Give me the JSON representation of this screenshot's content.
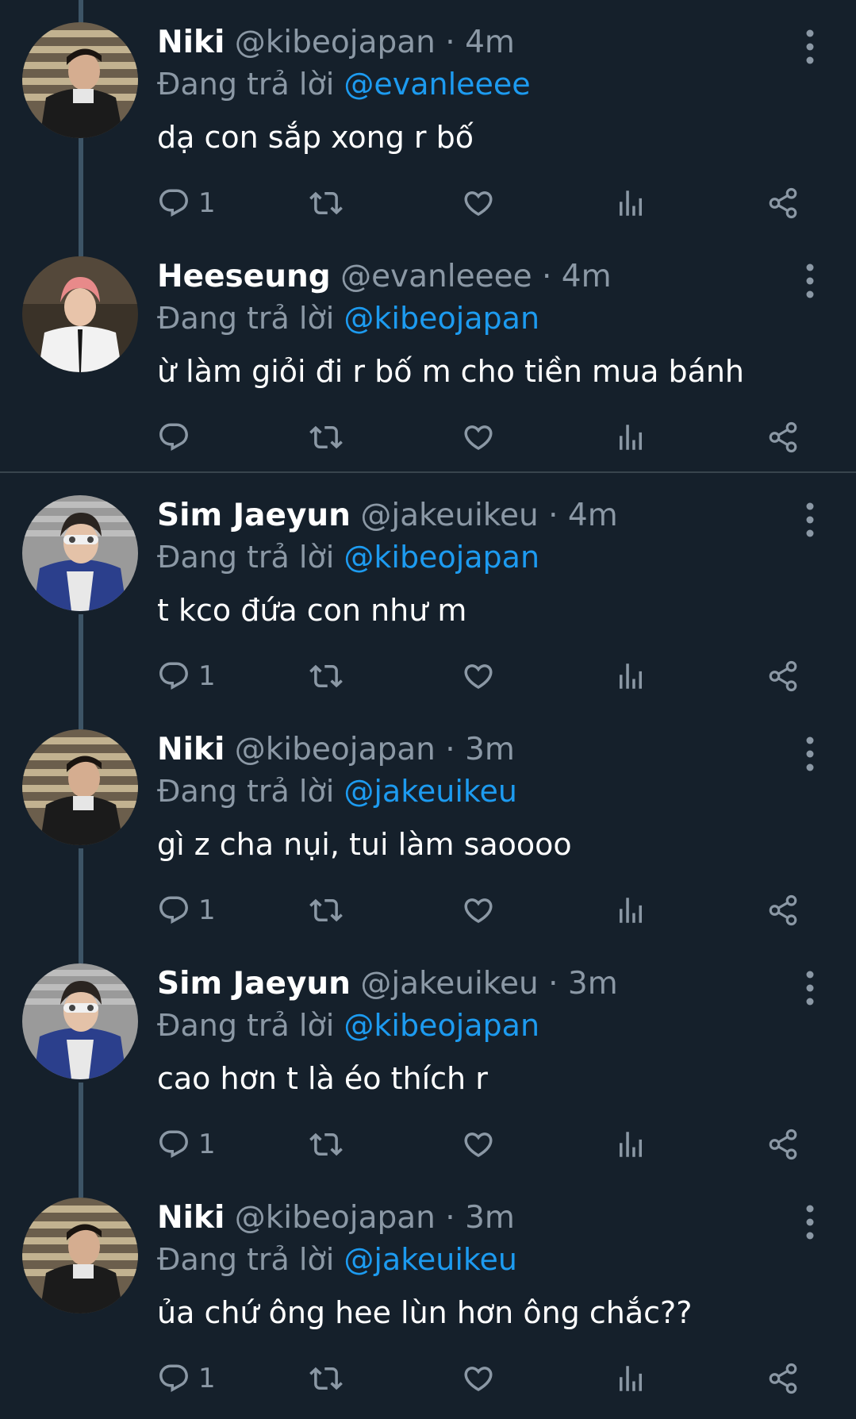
{
  "tweets": [
    {
      "name": "Niki",
      "handle": "@kibeojapan",
      "dot": "·",
      "time": "4m",
      "reply_prefix": "Đang trả lời",
      "reply_to": "@evanleeee",
      "text": "dạ con sắp xong r bố",
      "reply_count": "1",
      "avatar": "niki"
    },
    {
      "name": "Heeseung",
      "handle": "@evanleeee",
      "dot": "·",
      "time": "4m",
      "reply_prefix": "Đang trả lời",
      "reply_to": "@kibeojapan",
      "text": "ừ làm giỏi đi r bố m cho tiền mua bánh",
      "reply_count": "",
      "avatar": "heeseung"
    },
    {
      "name": "Sim Jaeyun",
      "handle": "@jakeuikeu",
      "dot": "·",
      "time": "4m",
      "reply_prefix": "Đang trả lời",
      "reply_to": "@kibeojapan",
      "text": "t kco đứa con như m",
      "reply_count": "1",
      "avatar": "jaeyun"
    },
    {
      "name": "Niki",
      "handle": "@kibeojapan",
      "dot": "·",
      "time": "3m",
      "reply_prefix": "Đang trả lời",
      "reply_to": "@jakeuikeu",
      "text": "gì z cha nụi, tui làm saoooo",
      "reply_count": "1",
      "avatar": "niki"
    },
    {
      "name": "Sim Jaeyun",
      "handle": "@jakeuikeu",
      "dot": "·",
      "time": "3m",
      "reply_prefix": "Đang trả lời",
      "reply_to": "@kibeojapan",
      "text": "cao hơn t là éo thích r",
      "reply_count": "1",
      "avatar": "jaeyun"
    },
    {
      "name": "Niki",
      "handle": "@kibeojapan",
      "dot": "·",
      "time": "3m",
      "reply_prefix": "Đang trả lời",
      "reply_to": "@jakeuikeu",
      "text": "ủa chứ ông hee lùn hơn ông chắc??",
      "reply_count": "1",
      "avatar": "niki"
    }
  ],
  "icons": [
    "reply-icon",
    "retweet-icon",
    "like-icon",
    "views-icon",
    "share-icon",
    "more-icon"
  ],
  "colors": {
    "background": "#15202b",
    "secondary_text": "#8b98a5",
    "link": "#1d9bf0",
    "thread_line": "#3d5466",
    "separator": "#38444d"
  }
}
